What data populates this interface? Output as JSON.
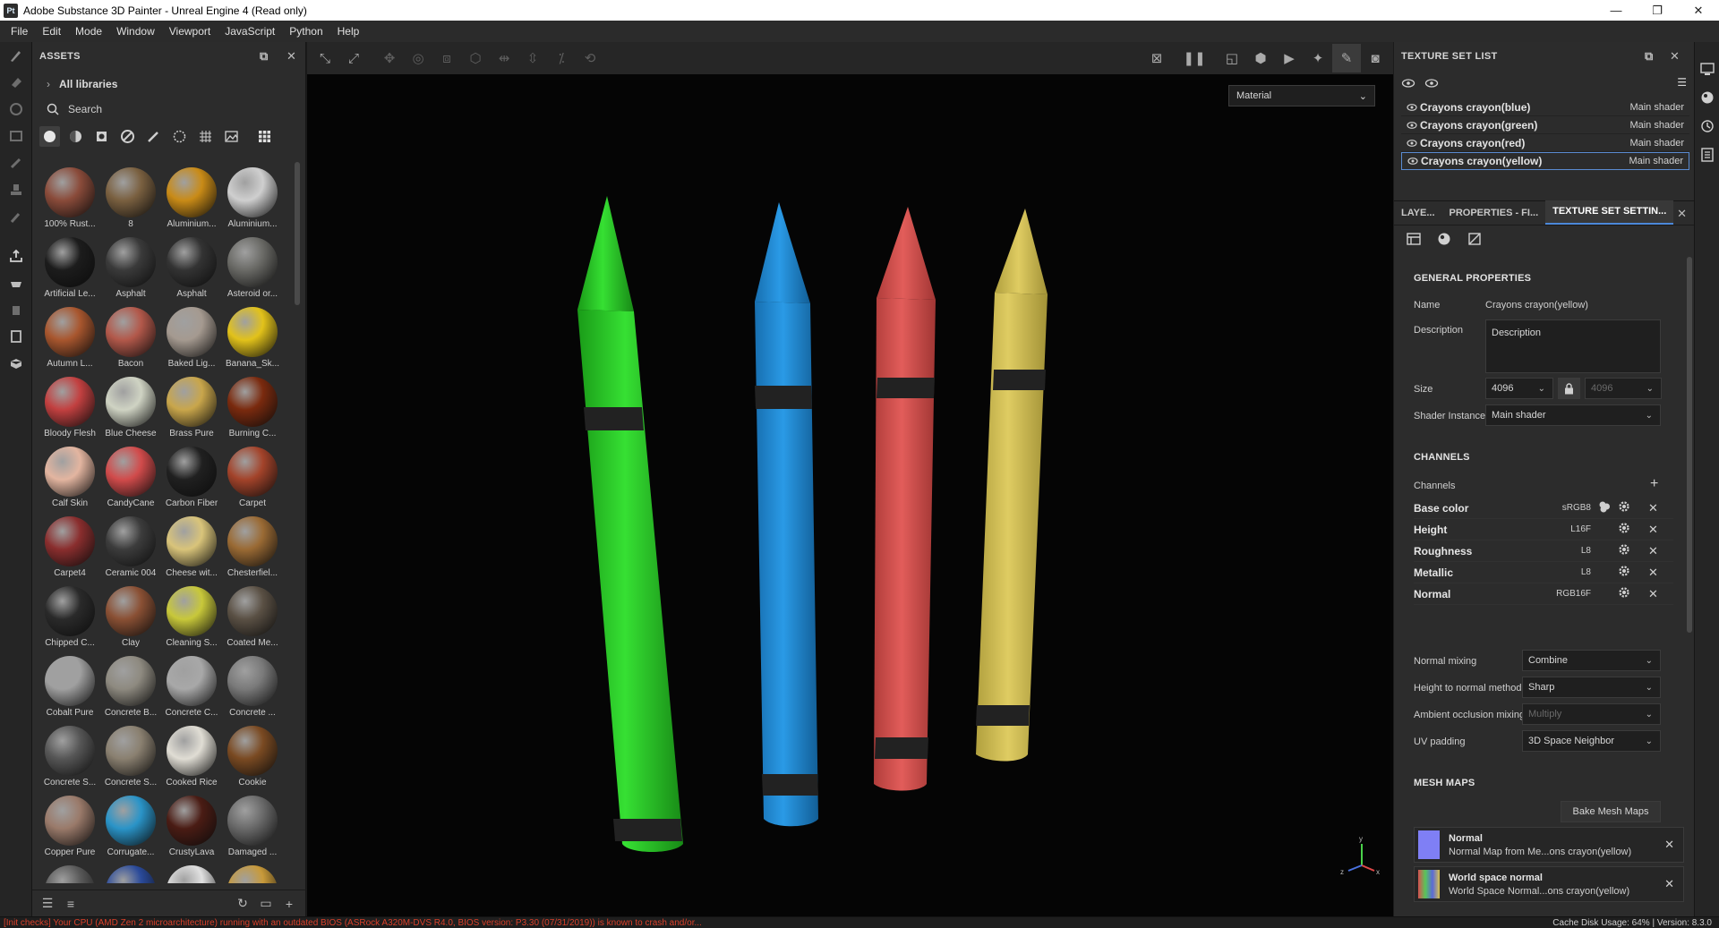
{
  "window": {
    "app_icon_text": "Pt",
    "title": "Adobe Substance 3D Painter - Unreal Engine 4 (Read only)",
    "minimize": "—",
    "maximize": "❐",
    "close": "✕"
  },
  "menu": [
    "File",
    "Edit",
    "Mode",
    "Window",
    "Viewport",
    "JavaScript",
    "Python",
    "Help"
  ],
  "assets": {
    "title": "ASSETS",
    "library": "All libraries",
    "search_placeholder": "Search",
    "items": [
      {
        "label": "100% Rust...",
        "color": "#8a4b3a"
      },
      {
        "label": "8",
        "color": "#7a6040"
      },
      {
        "label": "Aluminium...",
        "color": "#c98b17"
      },
      {
        "label": "Aluminium...",
        "color": "#cfcfcf"
      },
      {
        "label": "Artificial Le...",
        "color": "#1c1c1c"
      },
      {
        "label": "Asphalt",
        "color": "#3a3a3a"
      },
      {
        "label": "Asphalt",
        "color": "#333333"
      },
      {
        "label": "Asteroid or...",
        "color": "#6a6a66"
      },
      {
        "label": "Autumn L...",
        "color": "#a8562e"
      },
      {
        "label": "Bacon",
        "color": "#b2584a"
      },
      {
        "label": "Baked Lig...",
        "color": "#a59a90"
      },
      {
        "label": "Banana_Sk...",
        "color": "#e2c21a"
      },
      {
        "label": "Bloody Flesh",
        "color": "#c24040"
      },
      {
        "label": "Blue Cheese",
        "color": "#cfd3c3"
      },
      {
        "label": "Brass Pure",
        "color": "#c9a64b"
      },
      {
        "label": "Burning C...",
        "color": "#7a2a0e"
      },
      {
        "label": "Calf Skin",
        "color": "#e3b5a0"
      },
      {
        "label": "CandyCane",
        "color": "#d14b4b"
      },
      {
        "label": "Carbon Fiber",
        "color": "#202020"
      },
      {
        "label": "Carpet",
        "color": "#a3432a"
      },
      {
        "label": "Carpet4",
        "color": "#8a2e2e"
      },
      {
        "label": "Ceramic 004",
        "color": "#3c3c3c"
      },
      {
        "label": "Cheese wit...",
        "color": "#d9c47a"
      },
      {
        "label": "Chesterfiel...",
        "color": "#9a6a34"
      },
      {
        "label": "Chipped C...",
        "color": "#2a2a2a"
      },
      {
        "label": "Clay",
        "color": "#8a5034"
      },
      {
        "label": "Cleaning S...",
        "color": "#c8c83a"
      },
      {
        "label": "Coated Me...",
        "color": "#5a5044"
      },
      {
        "label": "Cobalt Pure",
        "color": "#a0a0a0"
      },
      {
        "label": "Concrete B...",
        "color": "#8e8a80"
      },
      {
        "label": "Concrete C...",
        "color": "#a8a8a8"
      },
      {
        "label": "Concrete ...",
        "color": "#7a7a7a"
      },
      {
        "label": "Concrete S...",
        "color": "#565656"
      },
      {
        "label": "Concrete S...",
        "color": "#8a8070"
      },
      {
        "label": "Cooked Rice",
        "color": "#e0ddd4"
      },
      {
        "label": "Cookie",
        "color": "#7a4a22"
      },
      {
        "label": "Copper Pure",
        "color": "#9a7a6a"
      },
      {
        "label": "Corrugate...",
        "color": "#2a94c8"
      },
      {
        "label": "CrustyLava",
        "color": "#4a1c14"
      },
      {
        "label": "Damaged ...",
        "color": "#6a6a6a"
      },
      {
        "label": "",
        "color": "#5a5a5a"
      },
      {
        "label": "",
        "color": "#2a4a9a"
      },
      {
        "label": "",
        "color": "#e0e0e0"
      },
      {
        "label": "",
        "color": "#c89a3a"
      }
    ]
  },
  "viewport": {
    "material_mode": "Material",
    "colors": {
      "green": "#2fd12c",
      "blue": "#1f8fd8",
      "red": "#d9524f",
      "yellow": "#d5c255",
      "band": "#222222"
    }
  },
  "texture_set_list": {
    "title": "TEXTURE SET LIST",
    "rows": [
      {
        "name": "Crayons crayon(blue)",
        "shader": "Main shader"
      },
      {
        "name": "Crayons crayon(green)",
        "shader": "Main shader"
      },
      {
        "name": "Crayons crayon(red)",
        "shader": "Main shader"
      },
      {
        "name": "Crayons crayon(yellow)",
        "shader": "Main shader"
      }
    ]
  },
  "tabs": [
    "LAYE...",
    "PROPERTIES - FI...",
    "TEXTURE SET SETTIN..."
  ],
  "general": {
    "heading": "GENERAL PROPERTIES",
    "name_label": "Name",
    "name_value": "Crayons crayon(yellow)",
    "description_label": "Description",
    "description_placeholder": "Description",
    "size_label": "Size",
    "size_value": "4096",
    "size_value2": "4096",
    "shader_label": "Shader Instance",
    "shader_value": "Main shader"
  },
  "channels": {
    "heading": "CHANNELS",
    "label": "Channels",
    "items": [
      {
        "name": "Base color",
        "format": "sRGB8"
      },
      {
        "name": "Height",
        "format": "L16F"
      },
      {
        "name": "Roughness",
        "format": "L8"
      },
      {
        "name": "Metallic",
        "format": "L8"
      },
      {
        "name": "Normal",
        "format": "RGB16F"
      }
    ]
  },
  "mixing": {
    "normal_mixing_label": "Normal mixing",
    "normal_mixing_value": "Combine",
    "height_to_normal_label": "Height to normal method",
    "height_to_normal_value": "Sharp",
    "ao_mixing_label": "Ambient occlusion mixing",
    "ao_mixing_value": "Multiply",
    "uv_padding_label": "UV padding",
    "uv_padding_value": "3D Space Neighbor"
  },
  "mesh_maps": {
    "heading": "MESH MAPS",
    "bake_button": "Bake Mesh Maps",
    "items": [
      {
        "title": "Normal",
        "subtitle": "Normal Map from Me...ons crayon(yellow)"
      },
      {
        "title": "World space normal",
        "subtitle": "World Space Normal...ons crayon(yellow)"
      }
    ]
  },
  "status": {
    "warning": "[Init checks] Your CPU (AMD Zen 2 microarchitecture) running with an outdated BIOS (ASRock A320M-DVS R4.0, BIOS version: P3.30 (07/31/2019)) is known to crash and/or...",
    "right": "Cache Disk Usage:   64%  |  Version: 8.3.0"
  }
}
